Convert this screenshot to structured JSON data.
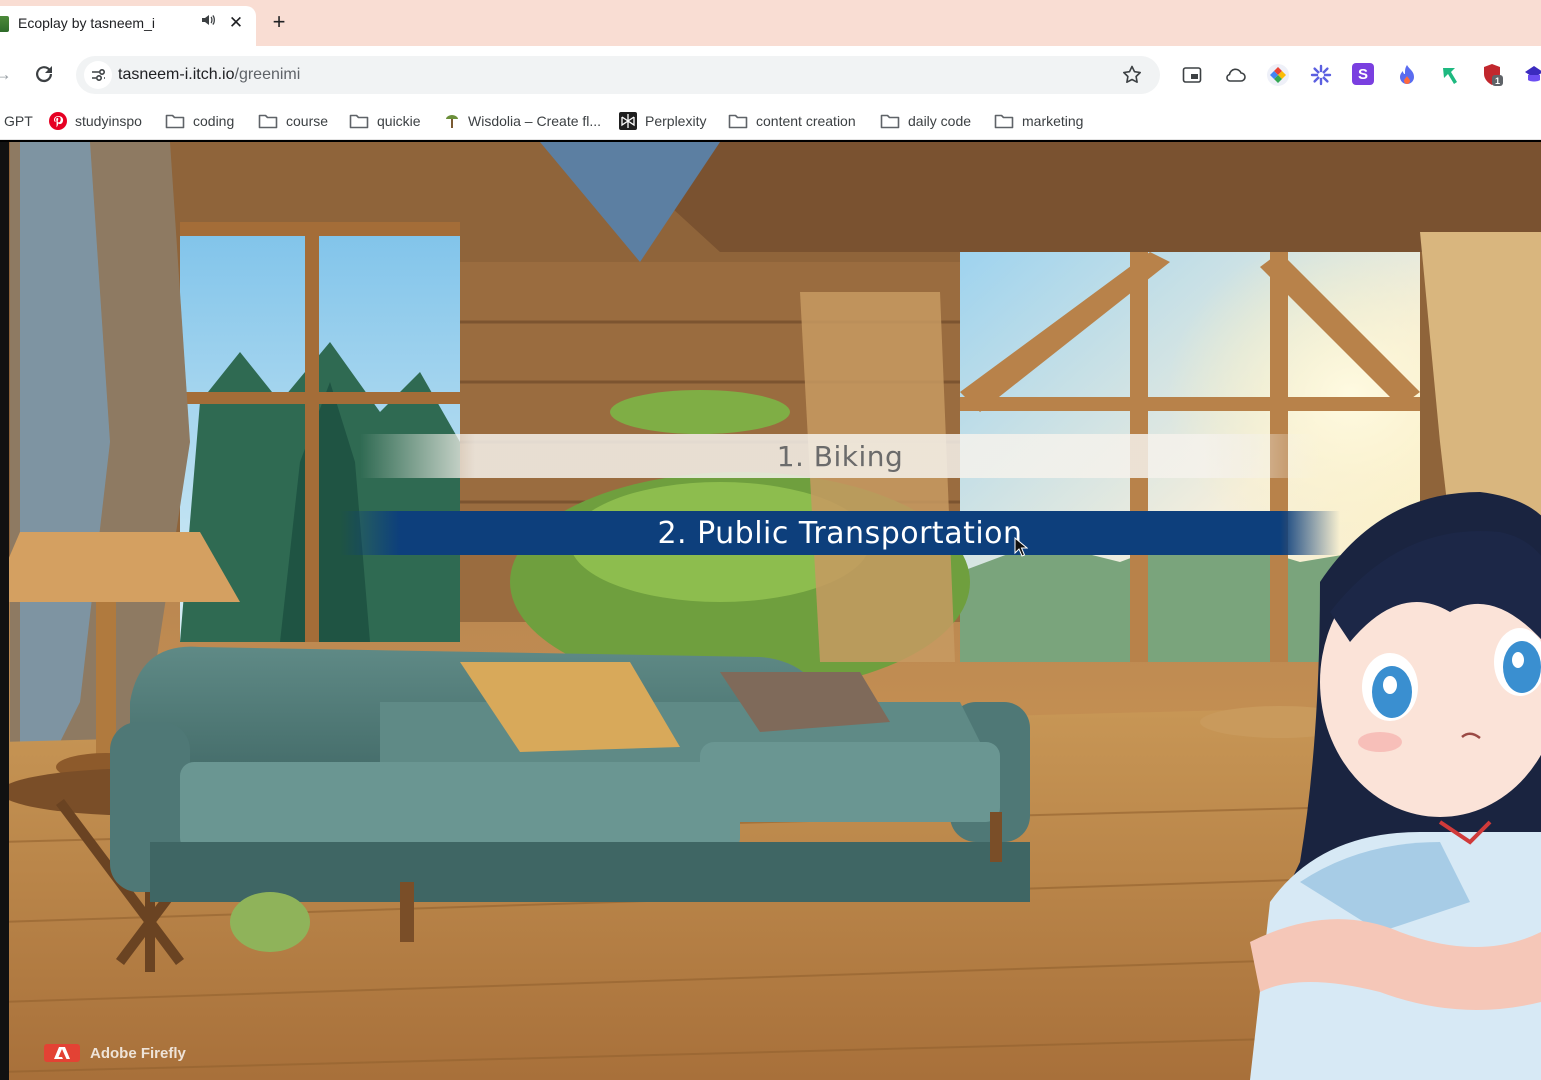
{
  "browser": {
    "tab": {
      "title": "Ecoplay by tasneem_i",
      "close_glyph": "✕",
      "audio_glyph": "🔊"
    },
    "new_tab_glyph": "+",
    "url": {
      "host": "tasneem-i.itch.io",
      "path": "/greenimi"
    },
    "bookmarks": [
      {
        "label": "GPT",
        "icon": "chatgpt-icon"
      },
      {
        "label": "studyinspo",
        "icon": "pinterest-icon"
      },
      {
        "label": "coding",
        "icon": "folder-icon"
      },
      {
        "label": "course",
        "icon": "folder-icon"
      },
      {
        "label": "quickie",
        "icon": "folder-icon"
      },
      {
        "label": "Wisdolia – Create fl...",
        "icon": "wisdolia-icon"
      },
      {
        "label": "Perplexity",
        "icon": "perplexity-icon"
      },
      {
        "label": "content creation",
        "icon": "folder-icon"
      },
      {
        "label": "daily code",
        "icon": "folder-icon"
      },
      {
        "label": "marketing",
        "icon": "folder-icon"
      }
    ],
    "extensions": [
      "picture-in-picture-icon",
      "cloud-icon",
      "colorful-extension-icon",
      "gear-flower-icon",
      "s-extension-icon",
      "flame-extension-icon",
      "arrow-extension-icon",
      "shield-extension-icon",
      "hat-extension-icon"
    ],
    "ext_s_letter": "S",
    "ext_badge": "1"
  },
  "game": {
    "choices": [
      {
        "label": "1. Biking",
        "selected": false
      },
      {
        "label": "2. Public Transportation",
        "selected": true
      }
    ],
    "watermark": "Adobe Firefly"
  },
  "colors": {
    "tabstrip": "#f9ddd3",
    "selected_choice": "#0d3f7c",
    "accent_red": "#e34234"
  }
}
